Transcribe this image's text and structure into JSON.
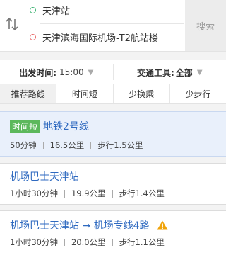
{
  "search": {
    "start": "天津站",
    "end": "天津滨海国际机场-T2航站楼",
    "button": "搜索",
    "icons": {
      "swap": "swap-icon",
      "start": "start-dot-icon",
      "end": "end-dot-icon"
    },
    "colors": {
      "start_dot": "#3cb371",
      "end_dot": "#e86a6a"
    }
  },
  "filters": {
    "departure_label": "出发时间:",
    "departure_value": "15:00",
    "transport_label": "交通工具:",
    "transport_value": "全部"
  },
  "tabs": [
    {
      "label": "推荐路线",
      "active": true
    },
    {
      "label": "时间短",
      "active": false
    },
    {
      "label": "少换乘",
      "active": false
    },
    {
      "label": "少步行",
      "active": false
    }
  ],
  "routes": [
    {
      "tag": "时间短",
      "title": "地铁2号线",
      "duration": "50分钟",
      "distance": "16.5公里",
      "walk": "步行1.5公里",
      "selected": true
    },
    {
      "title": "机场巴士天津站",
      "duration": "1小时30分钟",
      "distance": "19.9公里",
      "walk": "步行1.4公里"
    },
    {
      "title": "机场巴士天津站 → 机场专线4路",
      "duration": "1小时30分钟",
      "distance": "20.0公里",
      "walk": "步行1.1公里",
      "warning": true
    }
  ],
  "colors": {
    "link_blue": "#2f6ac0",
    "tag_green": "#5cb85c",
    "selected_bg": "#e9f0fb",
    "warning": "#f0a30a"
  }
}
